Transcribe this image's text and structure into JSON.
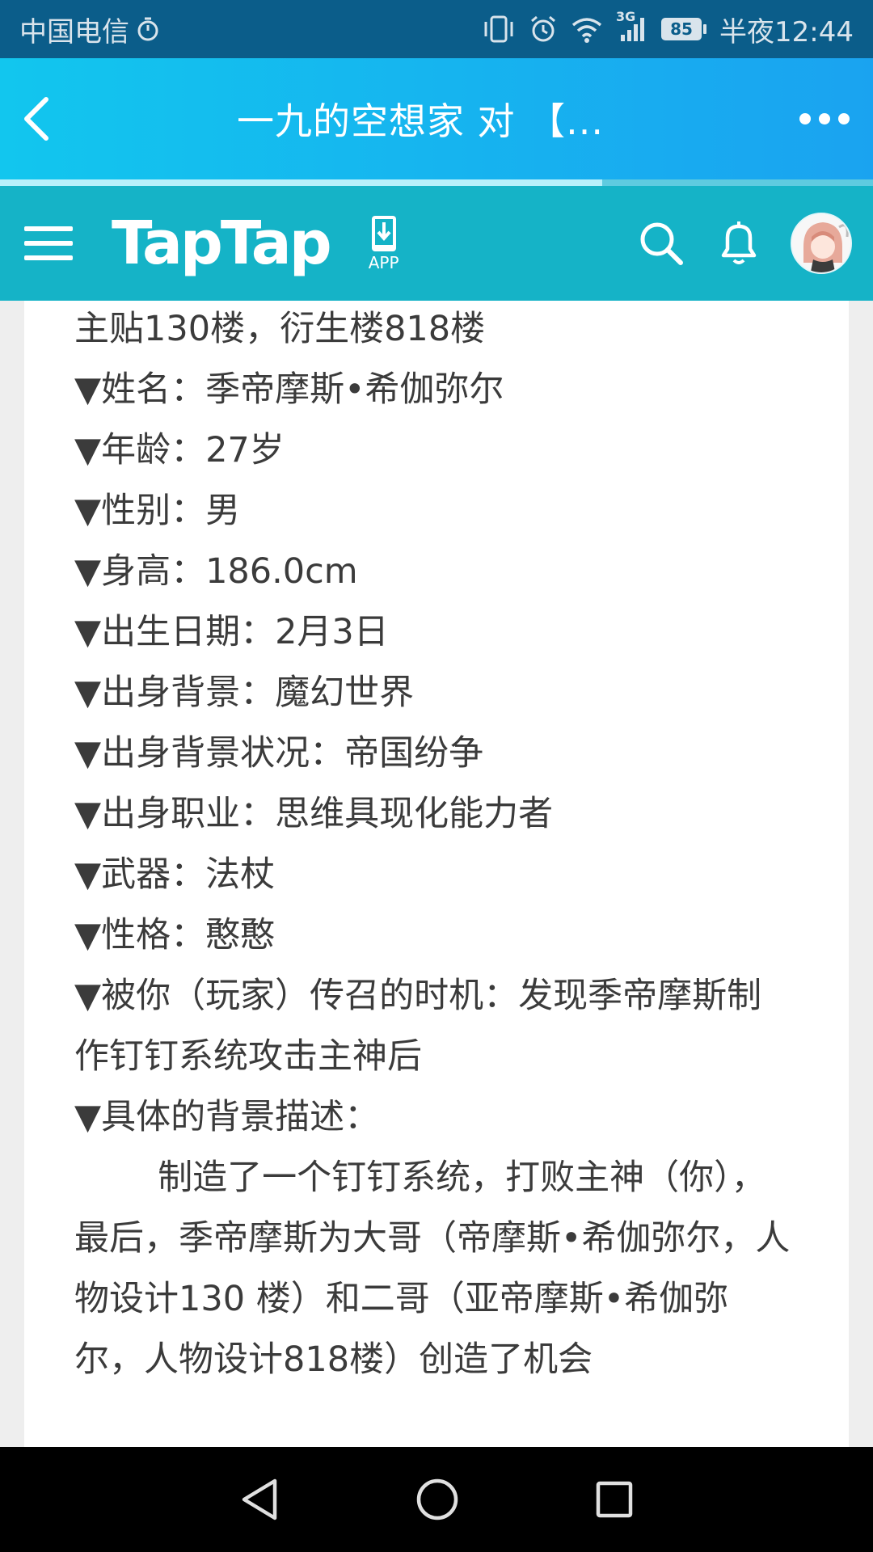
{
  "status_bar": {
    "carrier": "中国电信",
    "network": "3G",
    "battery": "85",
    "time": "半夜12:44"
  },
  "title_bar": {
    "title": "一九的空想家 对 【...",
    "progress": 0.69
  },
  "header": {
    "logo": "TapTap",
    "app_label": "APP"
  },
  "post": {
    "lines": [
      "主贴130楼，衍生楼818楼",
      "▼姓名：季帝摩斯•希伽弥尔",
      "▼年龄：27岁",
      "▼性别：男",
      "▼身高：186.0cm",
      "▼出生日期：2月3日",
      "▼出身背景：魔幻世界",
      "▼出身背景状况：帝国纷争",
      "▼出身职业：思维具现化能力者",
      "▼武器：法杖",
      "▼性格：憨憨",
      "▼被你（玩家）传召的时机：发现季帝摩斯制作钉钉系统攻击主神后",
      "▼具体的背景描述："
    ],
    "paragraph": "制造了一个钉钉系统，打败主神（你），最后，季帝摩斯为大哥（帝摩斯•希伽弥尔，人物设计130 楼）和二哥（亚帝摩斯•希伽弥尔，人物设计818楼）创造了机会"
  },
  "colors": {
    "status_bar": "#0b5d8a",
    "title_bar": "#1aa3f0",
    "header": "#15b3c7",
    "text": "#3b3b3b"
  }
}
